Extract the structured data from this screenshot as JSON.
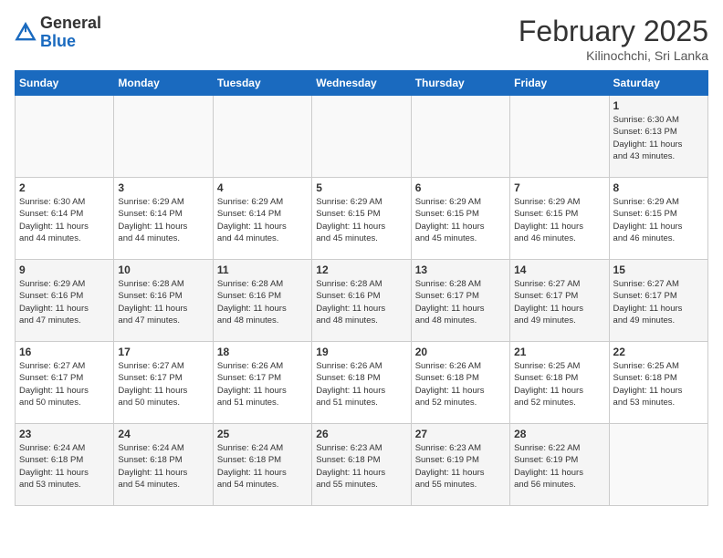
{
  "header": {
    "logo_general": "General",
    "logo_blue": "Blue",
    "title": "February 2025",
    "subtitle": "Kilinochchi, Sri Lanka"
  },
  "weekdays": [
    "Sunday",
    "Monday",
    "Tuesday",
    "Wednesday",
    "Thursday",
    "Friday",
    "Saturday"
  ],
  "weeks": [
    [
      {
        "day": "",
        "info": ""
      },
      {
        "day": "",
        "info": ""
      },
      {
        "day": "",
        "info": ""
      },
      {
        "day": "",
        "info": ""
      },
      {
        "day": "",
        "info": ""
      },
      {
        "day": "",
        "info": ""
      },
      {
        "day": "1",
        "info": "Sunrise: 6:30 AM\nSunset: 6:13 PM\nDaylight: 11 hours\nand 43 minutes."
      }
    ],
    [
      {
        "day": "2",
        "info": "Sunrise: 6:30 AM\nSunset: 6:14 PM\nDaylight: 11 hours\nand 44 minutes."
      },
      {
        "day": "3",
        "info": "Sunrise: 6:29 AM\nSunset: 6:14 PM\nDaylight: 11 hours\nand 44 minutes."
      },
      {
        "day": "4",
        "info": "Sunrise: 6:29 AM\nSunset: 6:14 PM\nDaylight: 11 hours\nand 44 minutes."
      },
      {
        "day": "5",
        "info": "Sunrise: 6:29 AM\nSunset: 6:15 PM\nDaylight: 11 hours\nand 45 minutes."
      },
      {
        "day": "6",
        "info": "Sunrise: 6:29 AM\nSunset: 6:15 PM\nDaylight: 11 hours\nand 45 minutes."
      },
      {
        "day": "7",
        "info": "Sunrise: 6:29 AM\nSunset: 6:15 PM\nDaylight: 11 hours\nand 46 minutes."
      },
      {
        "day": "8",
        "info": "Sunrise: 6:29 AM\nSunset: 6:15 PM\nDaylight: 11 hours\nand 46 minutes."
      }
    ],
    [
      {
        "day": "9",
        "info": "Sunrise: 6:29 AM\nSunset: 6:16 PM\nDaylight: 11 hours\nand 47 minutes."
      },
      {
        "day": "10",
        "info": "Sunrise: 6:28 AM\nSunset: 6:16 PM\nDaylight: 11 hours\nand 47 minutes."
      },
      {
        "day": "11",
        "info": "Sunrise: 6:28 AM\nSunset: 6:16 PM\nDaylight: 11 hours\nand 48 minutes."
      },
      {
        "day": "12",
        "info": "Sunrise: 6:28 AM\nSunset: 6:16 PM\nDaylight: 11 hours\nand 48 minutes."
      },
      {
        "day": "13",
        "info": "Sunrise: 6:28 AM\nSunset: 6:17 PM\nDaylight: 11 hours\nand 48 minutes."
      },
      {
        "day": "14",
        "info": "Sunrise: 6:27 AM\nSunset: 6:17 PM\nDaylight: 11 hours\nand 49 minutes."
      },
      {
        "day": "15",
        "info": "Sunrise: 6:27 AM\nSunset: 6:17 PM\nDaylight: 11 hours\nand 49 minutes."
      }
    ],
    [
      {
        "day": "16",
        "info": "Sunrise: 6:27 AM\nSunset: 6:17 PM\nDaylight: 11 hours\nand 50 minutes."
      },
      {
        "day": "17",
        "info": "Sunrise: 6:27 AM\nSunset: 6:17 PM\nDaylight: 11 hours\nand 50 minutes."
      },
      {
        "day": "18",
        "info": "Sunrise: 6:26 AM\nSunset: 6:17 PM\nDaylight: 11 hours\nand 51 minutes."
      },
      {
        "day": "19",
        "info": "Sunrise: 6:26 AM\nSunset: 6:18 PM\nDaylight: 11 hours\nand 51 minutes."
      },
      {
        "day": "20",
        "info": "Sunrise: 6:26 AM\nSunset: 6:18 PM\nDaylight: 11 hours\nand 52 minutes."
      },
      {
        "day": "21",
        "info": "Sunrise: 6:25 AM\nSunset: 6:18 PM\nDaylight: 11 hours\nand 52 minutes."
      },
      {
        "day": "22",
        "info": "Sunrise: 6:25 AM\nSunset: 6:18 PM\nDaylight: 11 hours\nand 53 minutes."
      }
    ],
    [
      {
        "day": "23",
        "info": "Sunrise: 6:24 AM\nSunset: 6:18 PM\nDaylight: 11 hours\nand 53 minutes."
      },
      {
        "day": "24",
        "info": "Sunrise: 6:24 AM\nSunset: 6:18 PM\nDaylight: 11 hours\nand 54 minutes."
      },
      {
        "day": "25",
        "info": "Sunrise: 6:24 AM\nSunset: 6:18 PM\nDaylight: 11 hours\nand 54 minutes."
      },
      {
        "day": "26",
        "info": "Sunrise: 6:23 AM\nSunset: 6:18 PM\nDaylight: 11 hours\nand 55 minutes."
      },
      {
        "day": "27",
        "info": "Sunrise: 6:23 AM\nSunset: 6:19 PM\nDaylight: 11 hours\nand 55 minutes."
      },
      {
        "day": "28",
        "info": "Sunrise: 6:22 AM\nSunset: 6:19 PM\nDaylight: 11 hours\nand 56 minutes."
      },
      {
        "day": "",
        "info": ""
      }
    ]
  ]
}
